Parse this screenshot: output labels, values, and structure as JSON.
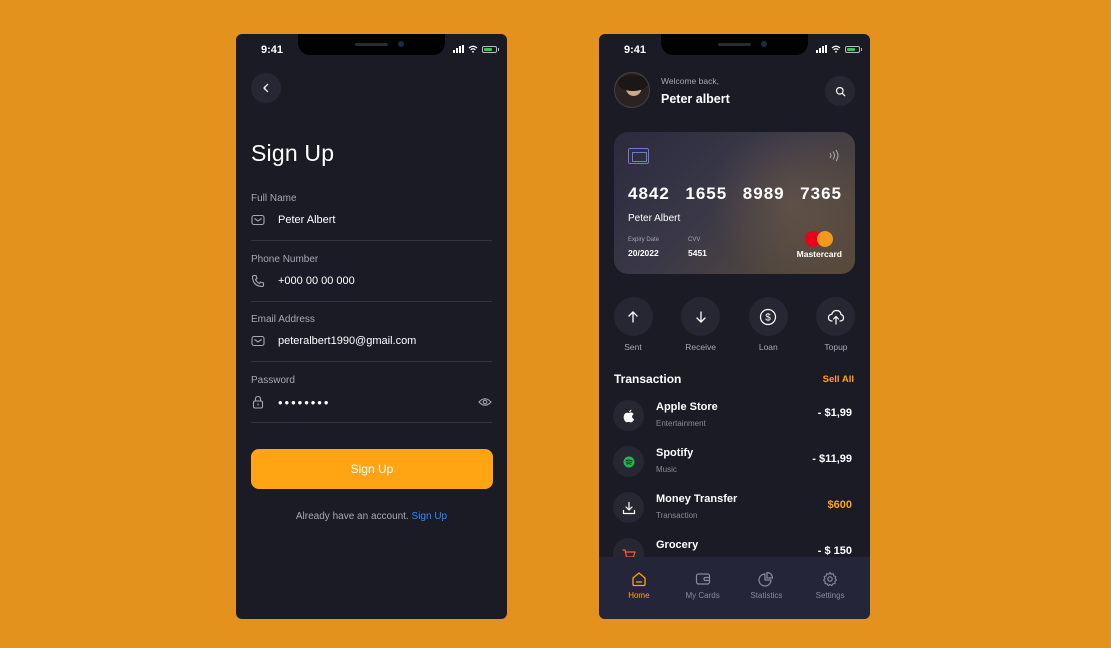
{
  "colors": {
    "background": "#E3921D",
    "phone": "#1B1B26",
    "accent": "#FFA412",
    "link": "#2E8BFF",
    "muted": "#A8A8B3"
  },
  "status_bar": {
    "time": "9:41"
  },
  "signup": {
    "title": "Sign Up",
    "fields": [
      {
        "label": "Full Name",
        "value": "Peter Albert",
        "icon": "mail-icon"
      },
      {
        "label": "Phone Number",
        "value": "+000 00 00 000",
        "icon": "phone-icon"
      },
      {
        "label": "Email Address",
        "value": "peteralbert1990@gmail.com",
        "icon": "mail-icon"
      },
      {
        "label": "Password",
        "value": "••••••••",
        "icon": "lock-icon"
      }
    ],
    "submit_label": "Sign Up",
    "account_prompt": "Already have an account.",
    "account_link": "Sign Up"
  },
  "home": {
    "welcome": "Welcome back,",
    "user_name": "Peter albert",
    "card": {
      "number_groups": [
        "4842",
        "1655",
        "8989",
        "7365"
      ],
      "holder": "Peter Albert",
      "expiry_label": "Expiry Date",
      "expiry_value": "20/2022",
      "cvv_label": "CVV",
      "cvv_value": "5451",
      "network": "Mastercard"
    },
    "actions": [
      {
        "label": "Sent",
        "icon": "arrow-up-icon"
      },
      {
        "label": "Receive",
        "icon": "arrow-down-icon"
      },
      {
        "label": "Loan",
        "icon": "dollar-icon"
      },
      {
        "label": "Topup",
        "icon": "upload-cloud-icon"
      }
    ],
    "transactions_title": "Transaction",
    "see_all": "Sell All",
    "transactions": [
      {
        "name": "Apple Store",
        "category": "Entertainment",
        "amount": "- $1,99",
        "icon": "apple-icon"
      },
      {
        "name": "Spotify",
        "category": "Music",
        "amount": "- $11,99",
        "icon": "spotify-icon"
      },
      {
        "name": "Money Transfer",
        "category": "Transaction",
        "amount": "$600",
        "icon": "download-icon"
      },
      {
        "name": "Grocery",
        "category": "",
        "amount": "- $ 150",
        "icon": "basket-icon"
      }
    ],
    "tabs": [
      {
        "label": "Home",
        "icon": "home-icon",
        "active": true
      },
      {
        "label": "My Cards",
        "icon": "wallet-icon",
        "active": false
      },
      {
        "label": "Statistics",
        "icon": "pie-chart-icon",
        "active": false
      },
      {
        "label": "Settings",
        "icon": "gear-icon",
        "active": false
      }
    ]
  }
}
